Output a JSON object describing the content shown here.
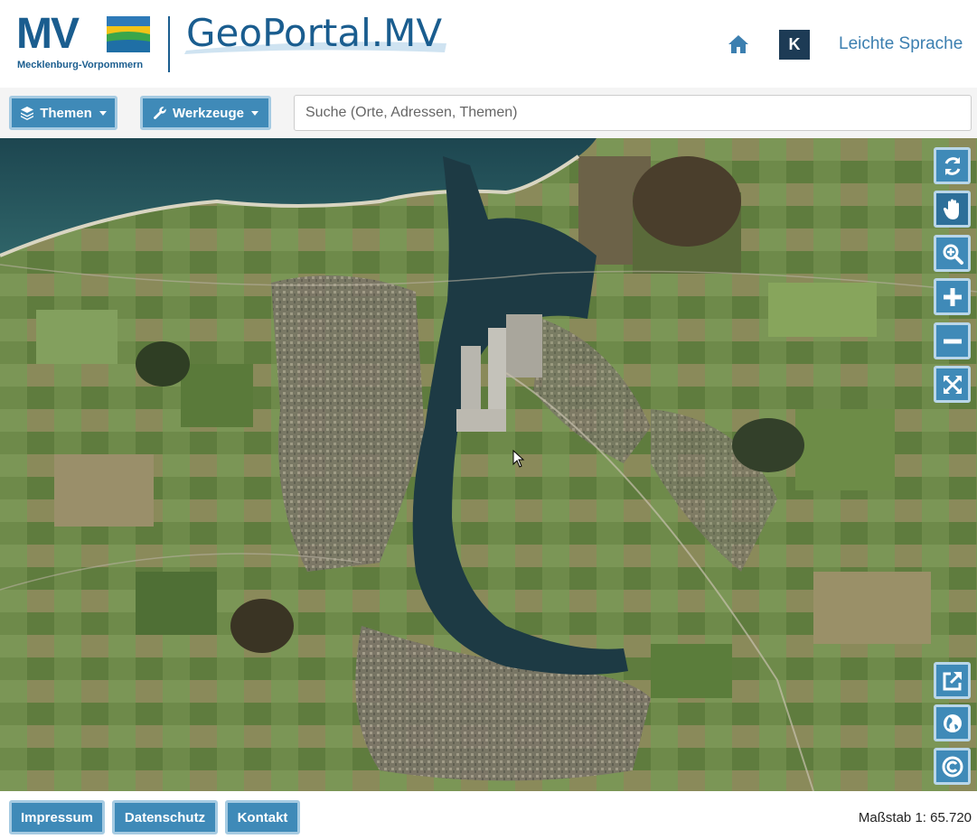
{
  "header": {
    "logo_text": "MV",
    "logo_subtitle": "Mecklenburg-Vorpommern",
    "portal_title": "GeoPortal.MV",
    "contrast_button": "K",
    "leichte_sprache": "Leichte Sprache"
  },
  "toolbar": {
    "themen_label": "Themen",
    "werkzeuge_label": "Werkzeuge",
    "search_placeholder": "Suche (Orte, Adressen, Themen)"
  },
  "map_controls": {
    "top": [
      "refresh-icon",
      "pan-hand-icon",
      "zoom-box-icon",
      "zoom-in-icon",
      "zoom-out-icon",
      "fullscreen-icon"
    ],
    "bottom": [
      "external-link-icon",
      "globe-icon",
      "copyright-icon"
    ]
  },
  "footer": {
    "impressum": "Impressum",
    "datenschutz": "Datenschutz",
    "kontakt": "Kontakt",
    "scale_text": "Maßstab 1: 65.720"
  },
  "colors": {
    "brand_blue": "#1a5d8f",
    "button_blue": "#3f8ab8",
    "button_border": "#a6cbe2",
    "contrast_dark": "#1d3b55"
  }
}
